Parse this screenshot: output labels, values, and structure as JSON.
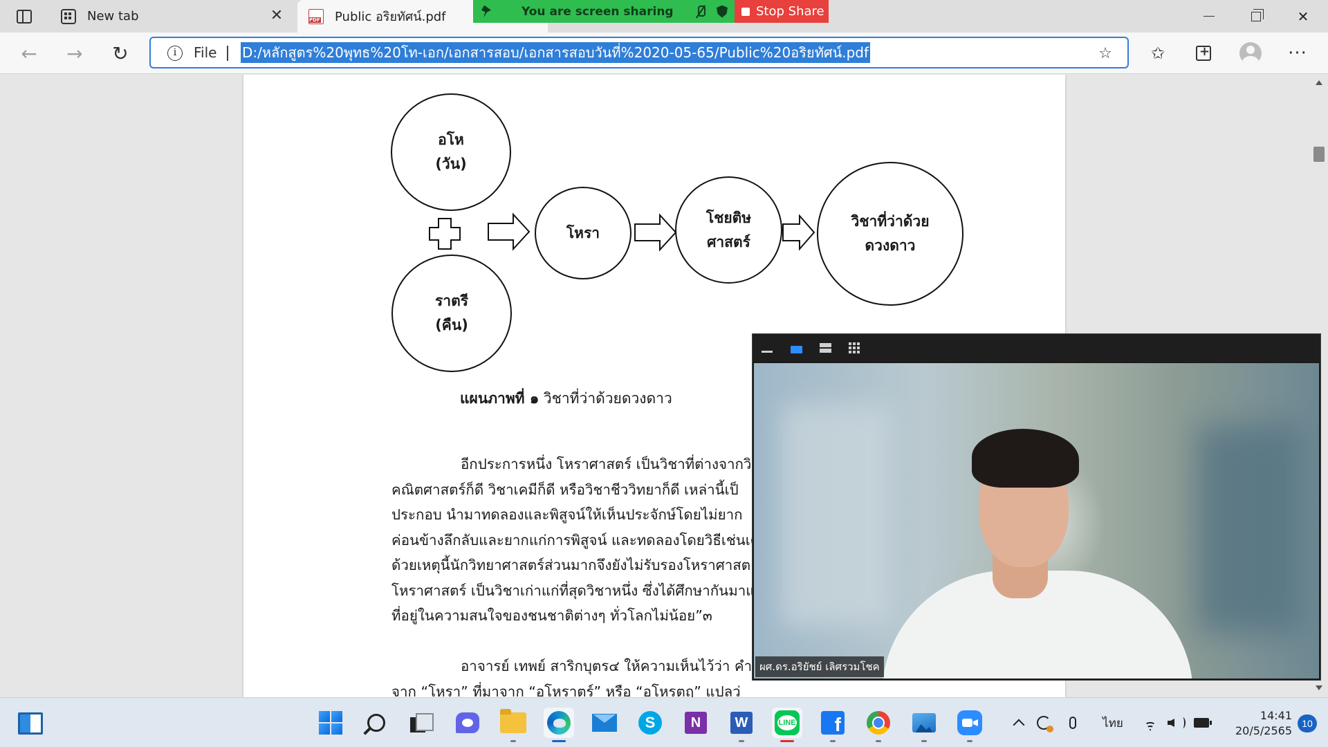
{
  "browser": {
    "tabs": [
      {
        "label": "New tab",
        "icon": "new-tab-icon",
        "active": false
      },
      {
        "label": "Public อริยทัศน์.pdf",
        "icon": "pdf-icon",
        "active": true
      }
    ],
    "address": {
      "scheme_label": "File",
      "url": "D:/หลักสูตร%20พุทธ%20โท-เอก/เอกสารสอบ/เอกสารสอบวันที่%2020-05-65/Public%20อริยทัศน์.pdf"
    },
    "accent_color": "#2f7ed8"
  },
  "screen_share": {
    "message": "You are screen sharing",
    "stop_label": "Stop Share",
    "banner_color": "#2fbd4f",
    "stop_color": "#e8403c"
  },
  "document": {
    "diagram": {
      "nodes": {
        "ohor": [
          "อโห",
          "(วัน)"
        ],
        "ratri": [
          "ราตรี",
          "(คืน)"
        ],
        "hora": [
          "โหรา"
        ],
        "jyotisha": [
          "โชยติษ",
          "ศาสตร์"
        ],
        "astrology": [
          "วิชาที่ว่าด้วย",
          "ดวงดาว"
        ]
      }
    },
    "caption": {
      "label": "แผนภาพที่ ๑",
      "text": " วิชาที่ว่าด้วยดวงดาว"
    },
    "paragraph1": [
      "อีกประการหนึ่ง โหราศาสตร์ เป็นวิชาที่ต่างจากวิ",
      "คณิตศาสตร์ก็ดี วิชาเคมีก็ดี หรือวิชาชีววิทยาก็ดี เหล่านี้เป็",
      "ประกอบ นำมาทดลองและพิสูจน์ให้เห็นประจักษ์โดยไม่ยาก",
      "ค่อนข้างลึกลับและยากแก่การพิสูจน์ และทดลองโดยวิธีเช่นเดีย",
      "ด้วยเหตุนี้นักวิทยาศาสตร์ส่วนมากจึงยังไม่รับรองโหราศาสต",
      "โหราศาสตร์ เป็นวิชาเก่าแก่ที่สุดวิชาหนึ่ง ซึ่งได้ศึกษากันมาแต่โ",
      "ที่อยู่ในความสนใจของชนชาติต่างๆ ทั่วโลกไม่น้อย”๓"
    ],
    "paragraph2": [
      "อาจารย์ เทพย์ สาริกบุตร๔ ให้ความเห็นไว้ว่า คำว่",
      "จาก “โหรา” ที่มาจาก “อโหราตร์” หรือ “อโหรตฤ” แปลว่"
    ]
  },
  "video": {
    "participant_name": "ผศ.ดร.อริยัชย์ เลิศรวมโชค",
    "active_view_color": "#2d8cff"
  },
  "taskbar": {
    "apps": [
      "start",
      "search",
      "task-view",
      "chat",
      "file-explorer",
      "edge",
      "mail",
      "skype",
      "onenote",
      "word",
      "line",
      "facebook",
      "chrome",
      "photos",
      "zoom"
    ],
    "skype_letter": "S",
    "onenote_letter": "N",
    "word_letter": "W",
    "line_label": "LINE",
    "facebook_letter": "f",
    "language": "ไทย",
    "time": "14:41",
    "date": "20/5/2565",
    "notification_count": "10"
  }
}
